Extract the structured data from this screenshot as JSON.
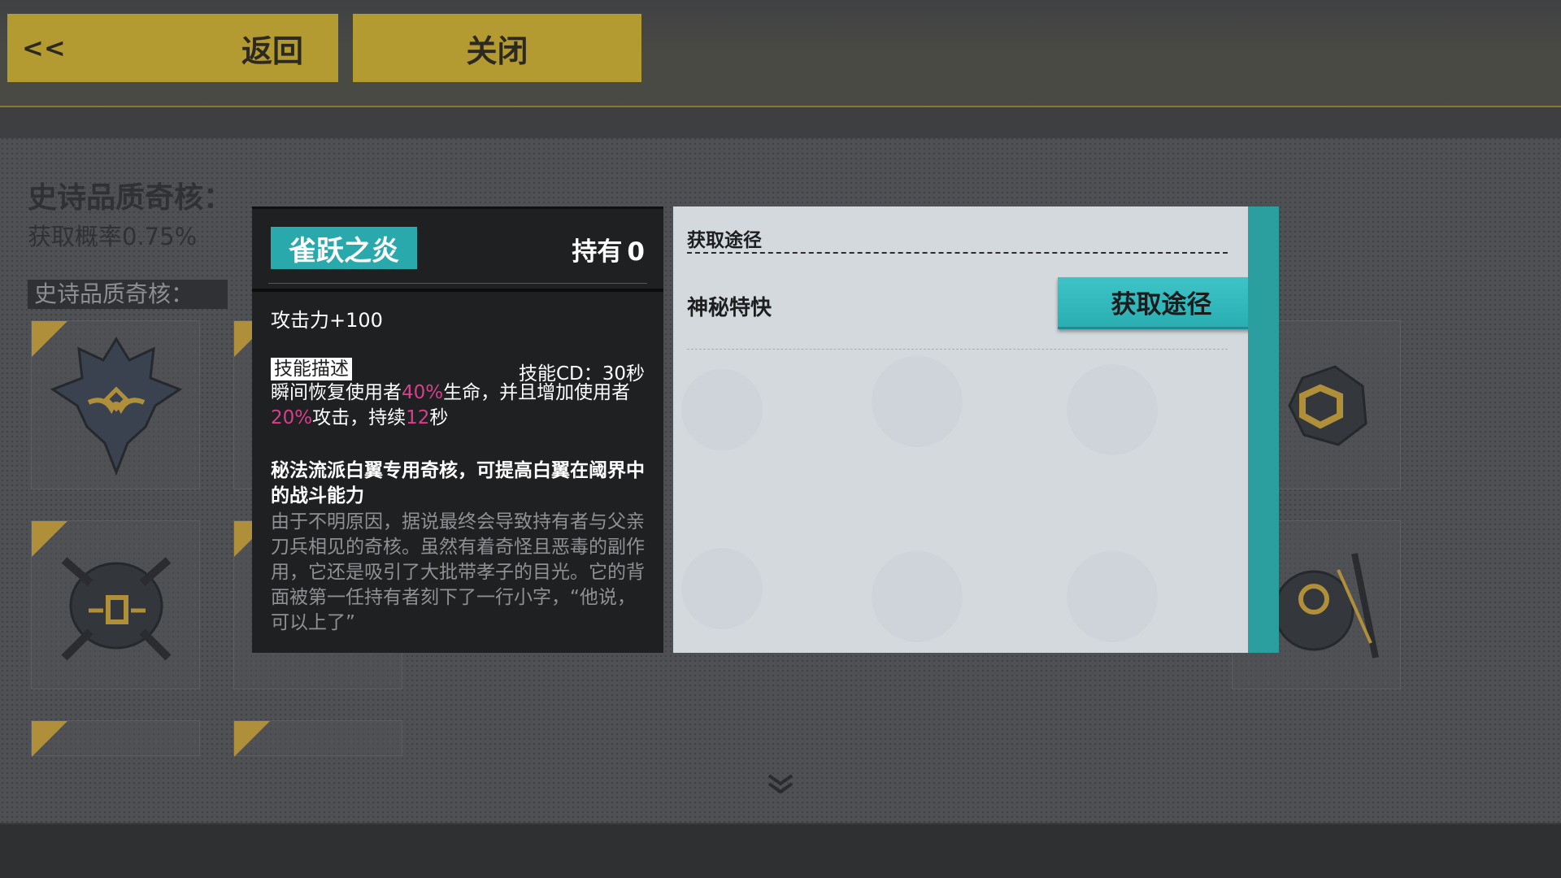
{
  "header": {
    "back_arrows": "<<",
    "back_label": "返回",
    "close_label": "关闭"
  },
  "background_list": {
    "epic_title": "史诗品质奇核：",
    "epic_rate": "获取概率0.75%",
    "epic_tag": "史诗品质奇核："
  },
  "item": {
    "name": "雀跃之炎",
    "owned_label": "持有",
    "owned_count": "0",
    "attack_stat": "攻击力+100",
    "skill_tag": "技能描述",
    "skill_cd": "技能CD：30秒",
    "skill_desc": {
      "p1": "瞬间恢复使用者",
      "v1": "40%",
      "p2": "生命，并且增加使用者",
      "v2": "20%",
      "p3": "攻击，持续",
      "v3": "12",
      "p4": "秒"
    },
    "core_desc": "秘法流派白翼专用奇核，可提高白翼在阈界中的战斗能力",
    "flavor": "由于不明原因，据说最终会导致持有者与父亲刀兵相见的奇核。虽然有着奇怪且恶毒的副作用，它还是吸引了大批带孝子的目光。它的背面被第一任持有者刻下了一行小字，“他说，可以上了”"
  },
  "source": {
    "header": "获取途径",
    "entries": [
      {
        "name": "神秘特快",
        "button_label": "获取途径"
      }
    ]
  },
  "colors": {
    "accent_teal": "#2aa9ad",
    "highlight_pink": "#d63f8c",
    "button_yellow": "#b49b31"
  }
}
